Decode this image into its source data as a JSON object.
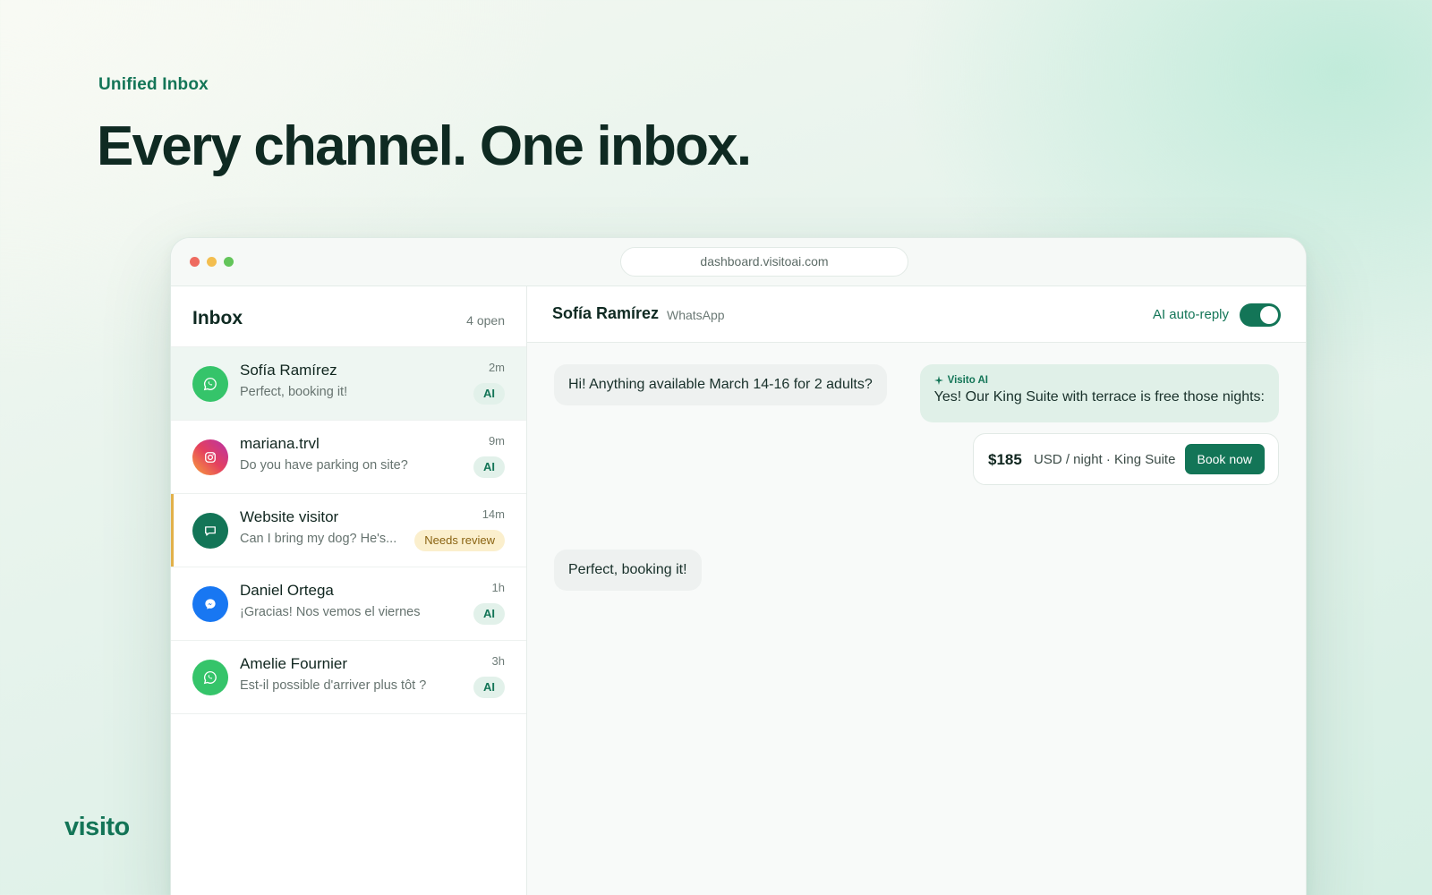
{
  "hero": {
    "eyebrow": "Unified Inbox",
    "headline": "Every channel. One inbox.",
    "brand": "visito"
  },
  "browser": {
    "url": "dashboard.visitoai.com",
    "dot_colors": [
      "#ee6b60",
      "#f3be4f",
      "#63c55a"
    ]
  },
  "inbox": {
    "title": "Inbox",
    "open_count": "4 open",
    "conversations": [
      {
        "name": "Sofía Ramírez",
        "preview": "Perfect, booking it!",
        "time": "2m",
        "badge": "AI",
        "channel": "whatsapp",
        "icon": "whatsapp-icon"
      },
      {
        "name": "mariana.trvl",
        "preview": "Do you have parking on site?",
        "time": "9m",
        "badge": "AI",
        "channel": "instagram",
        "icon": "instagram-icon"
      },
      {
        "name": "Website visitor",
        "preview": "Can I bring my dog? He's...",
        "time": "14m",
        "badge": "Needs review",
        "channel": "webchat",
        "icon": "chat-icon"
      },
      {
        "name": "Daniel Ortega",
        "preview": "¡Gracias! Nos vemos el viernes",
        "time": "1h",
        "badge": "AI",
        "channel": "messenger",
        "icon": "messenger-icon"
      },
      {
        "name": "Amelie Fournier",
        "preview": "Est-il possible d'arriver plus tôt ?",
        "time": "3h",
        "badge": "AI",
        "channel": "whatsapp",
        "icon": "whatsapp-icon"
      }
    ]
  },
  "chat": {
    "contact_name": "Sofía Ramírez",
    "contact_channel": "WhatsApp",
    "autoreply_label": "AI auto-reply",
    "autoreply_on": true,
    "messages": {
      "guest_1": "Hi! Anything available March 14-16 for 2 adults?",
      "ai_tag": "Visito AI",
      "ai_reply": "Yes! Our King Suite with terrace is free those nights:",
      "guest_2": "Perfect, booking it!"
    },
    "offer": {
      "price": "$185",
      "detail": "USD / night · King Suite",
      "button": "Book now"
    }
  },
  "colors": {
    "accent": "#137557",
    "whatsapp": "#35c46a",
    "messenger": "#1877f2",
    "webchat": "#137557",
    "review": "#e2b14a"
  }
}
